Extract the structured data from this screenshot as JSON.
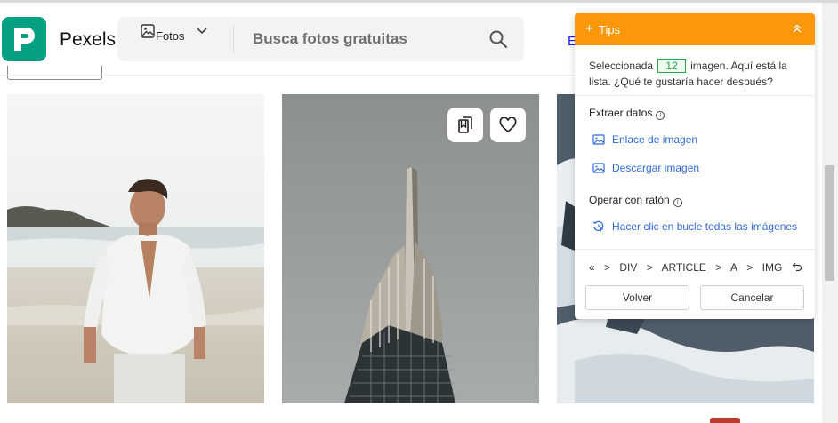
{
  "header": {
    "brand": "Pexels",
    "type_select": {
      "label": "Fotos"
    },
    "search": {
      "placeholder": "Busca fotos gratuitas"
    },
    "right_link_fragment": "E"
  },
  "photos": [
    {
      "alt": "man in white shirt on beach"
    },
    {
      "alt": "skyscraper spire against grey sky"
    },
    {
      "alt": "snowy mountain landscape"
    }
  ],
  "tips": {
    "title": "Tips",
    "message_before": "Seleccionada",
    "count": "12",
    "message_after": "imagen. Aquí está la lista. ¿Qué te gustaría hacer después?",
    "extract_title": "Extraer datos",
    "actions_extract": [
      {
        "label": "Enlace de imagen"
      },
      {
        "label": "Descargar imagen"
      }
    ],
    "mouse_title": "Operar con ratón",
    "actions_mouse": [
      {
        "label": "Hacer clic en bucle todas las imágenes"
      }
    ],
    "breadcrumb": [
      "«",
      ">",
      "DIV",
      ">",
      "ARTICLE",
      ">",
      "A",
      ">",
      "IMG"
    ],
    "back_label": "Volver",
    "cancel_label": "Cancelar"
  },
  "colors": {
    "accent_orange": "#fb9708",
    "brand_green": "#05a081",
    "link_blue": "#2f6bd8",
    "badge_green": "#2aa745"
  }
}
